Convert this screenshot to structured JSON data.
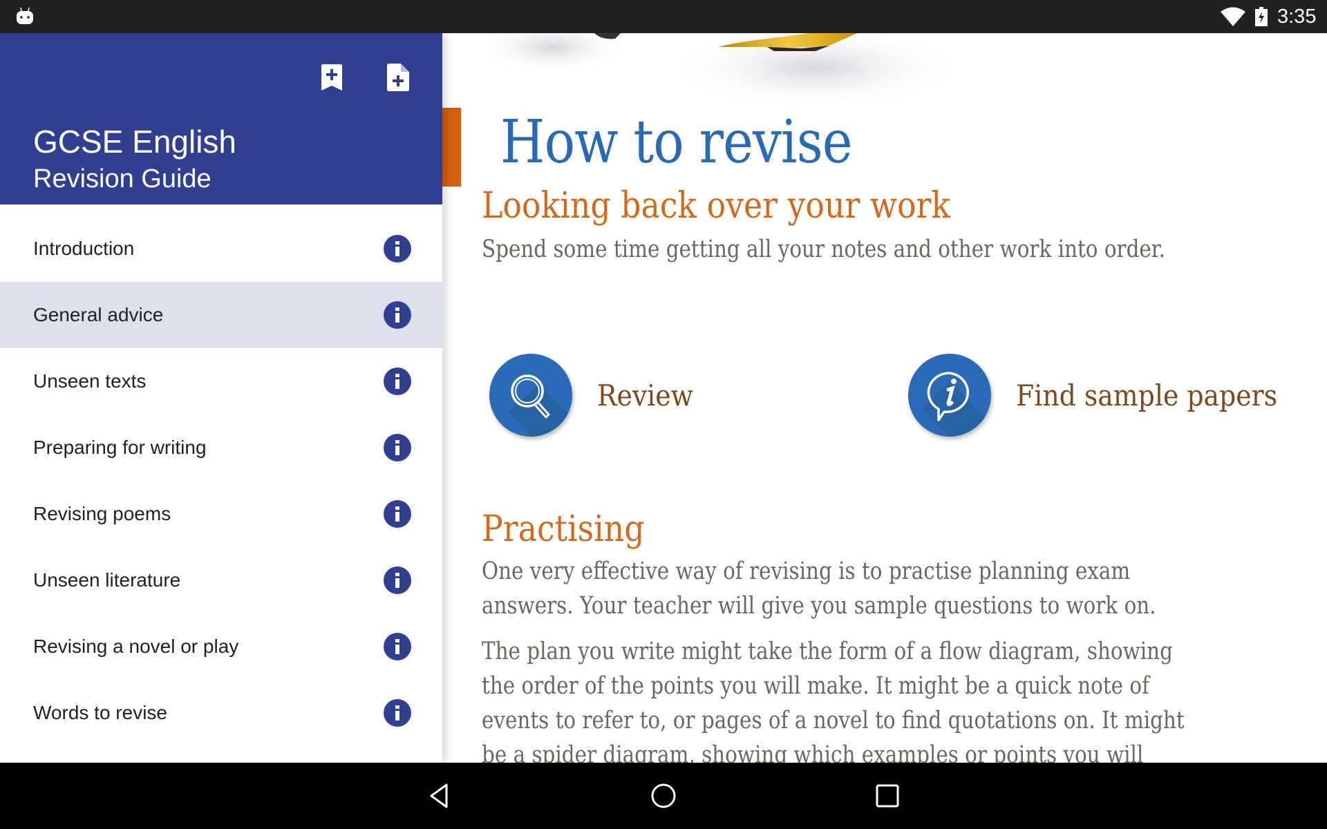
{
  "status_bar": {
    "time": "3:35",
    "icons": [
      "android-debug-icon",
      "wifi-icon",
      "battery-charging-icon"
    ]
  },
  "drawer": {
    "header": {
      "title": "GCSE English",
      "subtitle": "Revision Guide",
      "actions": [
        {
          "name": "add-bookmark",
          "icon": "bookmark-add-icon"
        },
        {
          "name": "add-note",
          "icon": "note-add-icon"
        }
      ],
      "background_color": "#303F8F"
    },
    "items": [
      {
        "label": "Introduction",
        "active": false
      },
      {
        "label": "General advice",
        "active": true
      },
      {
        "label": "Unseen texts",
        "active": false
      },
      {
        "label": "Preparing for writing",
        "active": false
      },
      {
        "label": "Revising poems",
        "active": false
      },
      {
        "label": "Unseen literature",
        "active": false
      },
      {
        "label": "Revising a novel or play",
        "active": false
      },
      {
        "label": "Words to revise",
        "active": false
      }
    ],
    "item_icon": "info-icon",
    "active_color": "#DDE1EC"
  },
  "content": {
    "page_title": "How to revise",
    "sections": [
      {
        "heading": "Looking back over your work",
        "paragraphs": [
          [
            "Spend some time getting all your notes and other work into order."
          ]
        ]
      },
      {
        "heading": "Practising",
        "paragraphs": [
          [
            "One very effective way of revising is to practise planning exam",
            "answers. Your teacher will give you sample questions to work on."
          ],
          [
            "The plan you write might take the form of a flow diagram, showing",
            "the order of the points you will make. It might be a quick note of",
            "events to refer to, or pages of a novel to find quotations on. It might",
            "be a spider diagram, showing which examples or points you will"
          ]
        ]
      }
    ],
    "links": [
      {
        "label": "Review",
        "icon": "search-icon"
      },
      {
        "label": "Find sample papers",
        "icon": "info-speech-bubble-icon"
      }
    ],
    "colors": {
      "title": "#2A6AB4",
      "heading": "#CF6A1E",
      "body": "#6A6660",
      "accent_bar": "#D2600F",
      "link_label": "#7A4A1E",
      "link_circle": "#2A6AB6"
    }
  },
  "system_nav": {
    "buttons": [
      "back-icon",
      "home-icon",
      "recents-icon"
    ]
  }
}
